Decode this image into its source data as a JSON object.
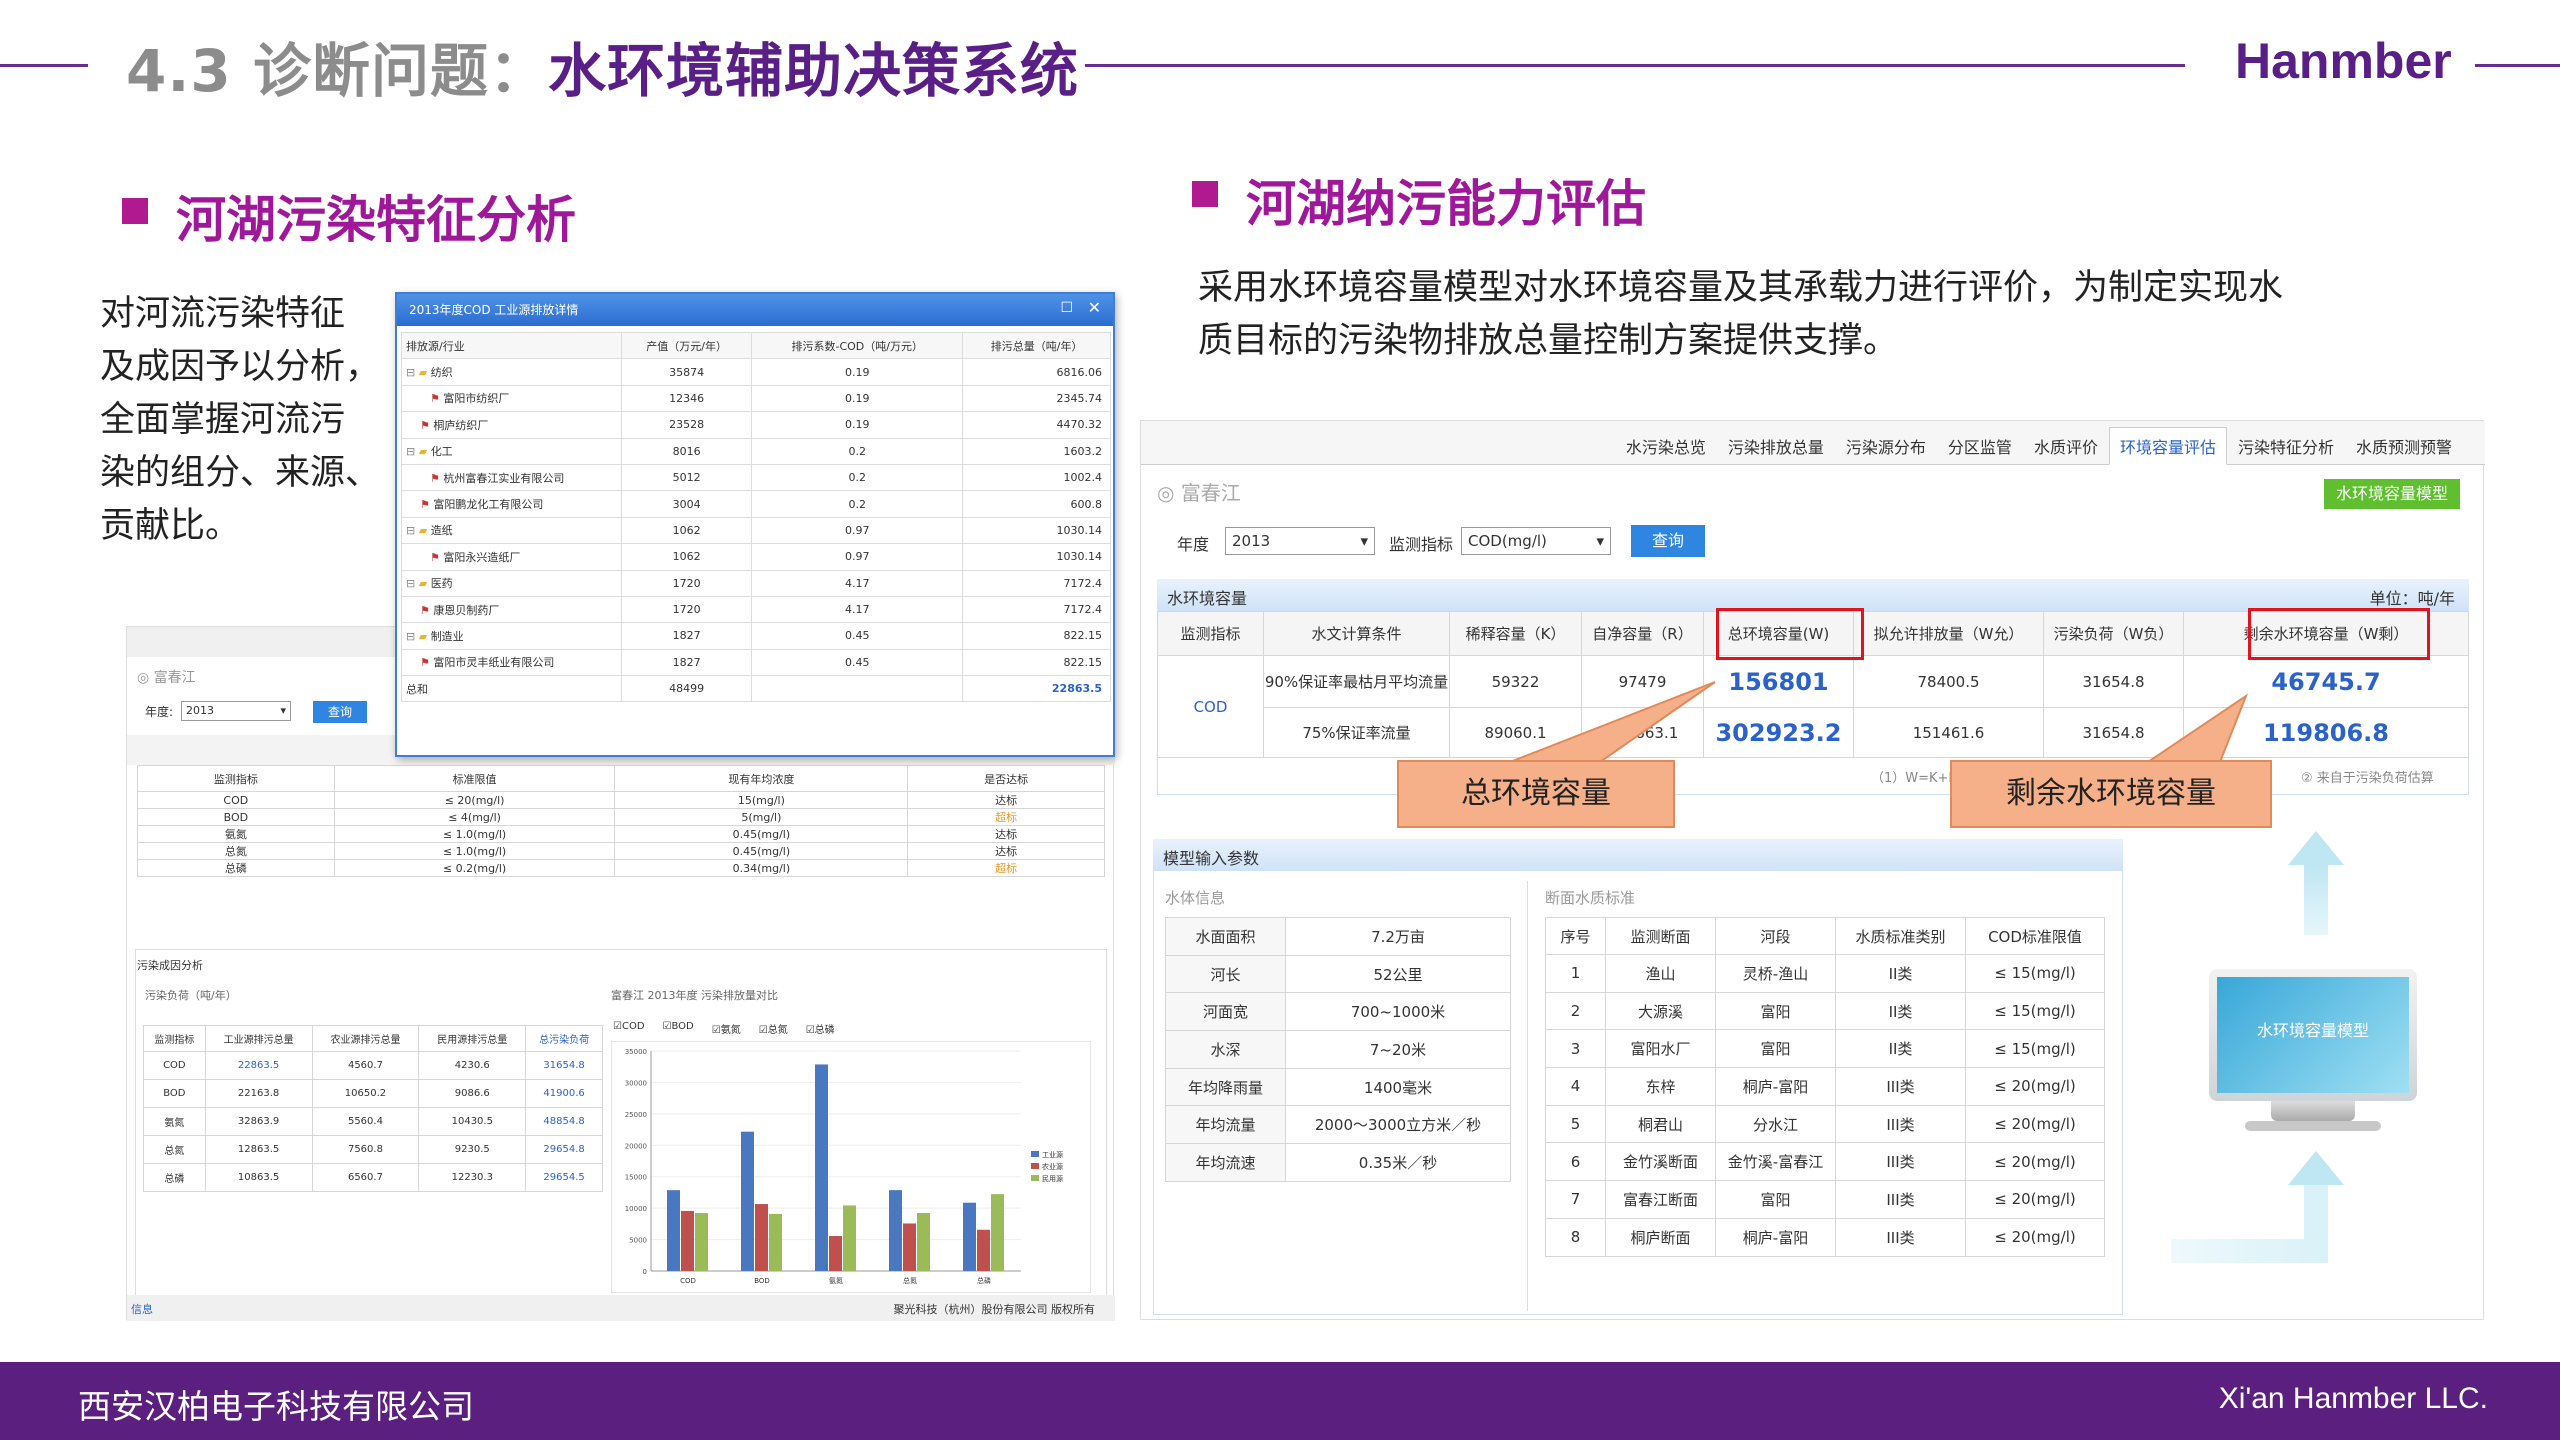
{
  "header": {
    "number": "4.3 诊断问题：",
    "title": "水环境辅助决策系统",
    "brand": "Hanmber"
  },
  "left_section": {
    "heading": "河湖污染特征分析",
    "lines": [
      "对河流污染特征",
      "及成因予以分析，",
      "全面掌握河流污",
      "染的组分、来源、",
      "贡献比。"
    ]
  },
  "right_section": {
    "heading": "河湖纳污能力评估",
    "lines": [
      "采用水环境容量模型对水环境容量及其承载力进行评价，为制定实现水",
      "质目标的污染物排放总量控制方案提供支撑。"
    ]
  },
  "footer": {
    "company_cn": "西安汉柏电子科技有限公司",
    "company_en": "Xi'an Hanmber LLC."
  },
  "left_shot": {
    "river": "富春江",
    "year_label": "年度:",
    "year": "2013",
    "query": "查询",
    "std_headers": [
      "监测指标",
      "标准限值",
      "现有年均浓度",
      "是否达标"
    ],
    "std_rows": [
      [
        "COD",
        "≤ 20(mg/l)",
        "15(mg/l)",
        "达标"
      ],
      [
        "BOD",
        "≤ 4(mg/l)",
        "5(mg/l)",
        "超标"
      ],
      [
        "氨氮",
        "≤ 1.0(mg/l)",
        "0.45(mg/l)",
        "达标"
      ],
      [
        "总氮",
        "≤ 1.0(mg/l)",
        "0.45(mg/l)",
        "达标"
      ],
      [
        "总磷",
        "≤ 0.2(mg/l)",
        "0.34(mg/l)",
        "超标"
      ]
    ],
    "cause_title": "污染成因分析",
    "load_title": "污染负荷（吨/年）",
    "load_headers": [
      "监测指标",
      "工业源排污总量",
      "农业源排污总量",
      "民用源排污总量",
      "总污染负荷"
    ],
    "load_rows": [
      [
        "COD",
        "22863.5",
        "4560.7",
        "4230.6",
        "31654.8"
      ],
      [
        "BOD",
        "22163.8",
        "10650.2",
        "9086.6",
        "41900.6"
      ],
      [
        "氨氮",
        "32863.9",
        "5560.4",
        "10430.5",
        "48854.8"
      ],
      [
        "总氮",
        "12863.5",
        "7560.8",
        "9230.5",
        "29654.8"
      ],
      [
        "总磷",
        "10863.5",
        "6560.7",
        "12230.3",
        "29654.5"
      ]
    ],
    "chart_title": "富春江 2013年度 污染排放量对比",
    "checks": [
      "COD",
      "BOD",
      "氨氮",
      "总氮",
      "总磷"
    ],
    "footer_left": "信息",
    "footer_right": "聚光科技（杭州）股份有限公司  版权所有"
  },
  "popup": {
    "title": "2013年度COD 工业源排放详情",
    "headers": [
      "排放源/行业",
      "产值（万元/年）",
      "排污系数-COD（吨/万元）",
      "排污总量（吨/年）"
    ],
    "rows": [
      [
        "纺织",
        "35874",
        "0.19",
        "6816.06"
      ],
      [
        "富阳市纺织厂",
        "12346",
        "0.19",
        "2345.74"
      ],
      [
        "桐庐纺织厂",
        "23528",
        "0.19",
        "4470.32"
      ],
      [
        "化工",
        "8016",
        "0.2",
        "1603.2"
      ],
      [
        "杭州富春江实业有限公司",
        "5012",
        "0.2",
        "1002.4"
      ],
      [
        "富阳鹏龙化工有限公司",
        "3004",
        "0.2",
        "600.8"
      ],
      [
        "造纸",
        "1062",
        "0.97",
        "1030.14"
      ],
      [
        "富阳永兴造纸厂",
        "1062",
        "0.97",
        "1030.14"
      ],
      [
        "医药",
        "1720",
        "4.17",
        "7172.4"
      ],
      [
        "康恩贝制药厂",
        "1720",
        "4.17",
        "7172.4"
      ],
      [
        "制造业",
        "1827",
        "0.45",
        "822.15"
      ],
      [
        "富阳市灵丰纸业有限公司",
        "1827",
        "0.45",
        "822.15"
      ],
      [
        "总和",
        "48499",
        "",
        "22863.5"
      ]
    ]
  },
  "right_shot": {
    "tabs": [
      "水污染总览",
      "污染排放总量",
      "污染源分布",
      "分区监管",
      "水质评价",
      "环境容量评估",
      "污染特征分析",
      "水质预测预警"
    ],
    "active_tab": 5,
    "river": "富春江",
    "model_btn": "水环境容量模型",
    "year_label": "年度",
    "year": "2013",
    "index_label": "监测指标",
    "index": "COD(mg/l)",
    "query": "查询",
    "cap_title": "水环境容量",
    "unit": "单位：吨/年",
    "cap_headers": [
      "监测指标",
      "水文计算条件",
      "稀释容量（K）",
      "自净容量（R）",
      "总环境容量(W)",
      "拟允许排放量（W允）",
      "污染负荷（W负）",
      "剩余水环境容量（W剩）"
    ],
    "cap_index": "COD",
    "cap_rows": [
      [
        "90%保证率最枯月平均流量",
        "59322",
        "97479",
        "156801",
        "78400.5",
        "31654.8",
        "46745.7"
      ],
      [
        "75%保证率流量",
        "89060.1",
        "213863.1",
        "302923.2",
        "151461.6",
        "31654.8",
        "119806.8"
      ]
    ],
    "note_left": "（1）W=K+R",
    "note_right": "来自于污染负荷估算",
    "callout_total": "总环境容量",
    "callout_remain": "剩余水环境容量",
    "param_title": "模型输入参数",
    "water_info": "水体信息",
    "params": [
      [
        "水面面积",
        "7.2万亩"
      ],
      [
        "河长",
        "52公里"
      ],
      [
        "河面宽",
        "700~1000米"
      ],
      [
        "水深",
        "7~20米"
      ],
      [
        "年均降雨量",
        "1400毫米"
      ],
      [
        "年均流量",
        "2000～3000立方米／秒"
      ],
      [
        "年均流速",
        "0.35米／秒"
      ]
    ],
    "section_std": "断面水质标准",
    "sec_headers": [
      "序号",
      "监测断面",
      "河段",
      "水质标准类别",
      "COD标准限值"
    ],
    "sec_rows": [
      [
        "1",
        "渔山",
        "灵桥-渔山",
        "II类",
        "≤ 15(mg/l)"
      ],
      [
        "2",
        "大源溪",
        "富阳",
        "II类",
        "≤ 15(mg/l)"
      ],
      [
        "3",
        "富阳水厂",
        "富阳",
        "II类",
        "≤ 15(mg/l)"
      ],
      [
        "4",
        "东梓",
        "桐庐-富阳",
        "III类",
        "≤ 20(mg/l)"
      ],
      [
        "5",
        "桐君山",
        "分水江",
        "III类",
        "≤ 20(mg/l)"
      ],
      [
        "6",
        "金竹溪断面",
        "金竹溪-富春江",
        "III类",
        "≤ 20(mg/l)"
      ],
      [
        "7",
        "富春江断面",
        "富阳",
        "III类",
        "≤ 20(mg/l)"
      ],
      [
        "8",
        "桐庐断面",
        "桐庐-富阳",
        "III类",
        "≤ 20(mg/l)"
      ]
    ],
    "monitor_label": "水环境容量模型"
  },
  "chart_data": {
    "type": "bar",
    "title": "富春江 2013年度 污染排放量对比",
    "categories": [
      "COD",
      "BOD",
      "氨氮",
      "总氮",
      "总磷"
    ],
    "series": [
      {
        "name": "工业源",
        "values": [
          12863.5,
          22163.8,
          32863.9,
          12863.5,
          10863.5
        ],
        "color": "#4a78c0"
      },
      {
        "name": "农业源",
        "values": [
          9560.7,
          10650.2,
          5560.4,
          7560.8,
          6560.7
        ],
        "color": "#c0504d"
      },
      {
        "name": "民用源",
        "values": [
          9230.6,
          9086.6,
          10430.5,
          9230.5,
          12230.3
        ],
        "color": "#9bbb59"
      }
    ],
    "ylim": [
      0,
      35000
    ],
    "yticks": [
      0,
      5000,
      10000,
      15000,
      20000,
      25000,
      30000,
      35000
    ],
    "legend": "right"
  }
}
